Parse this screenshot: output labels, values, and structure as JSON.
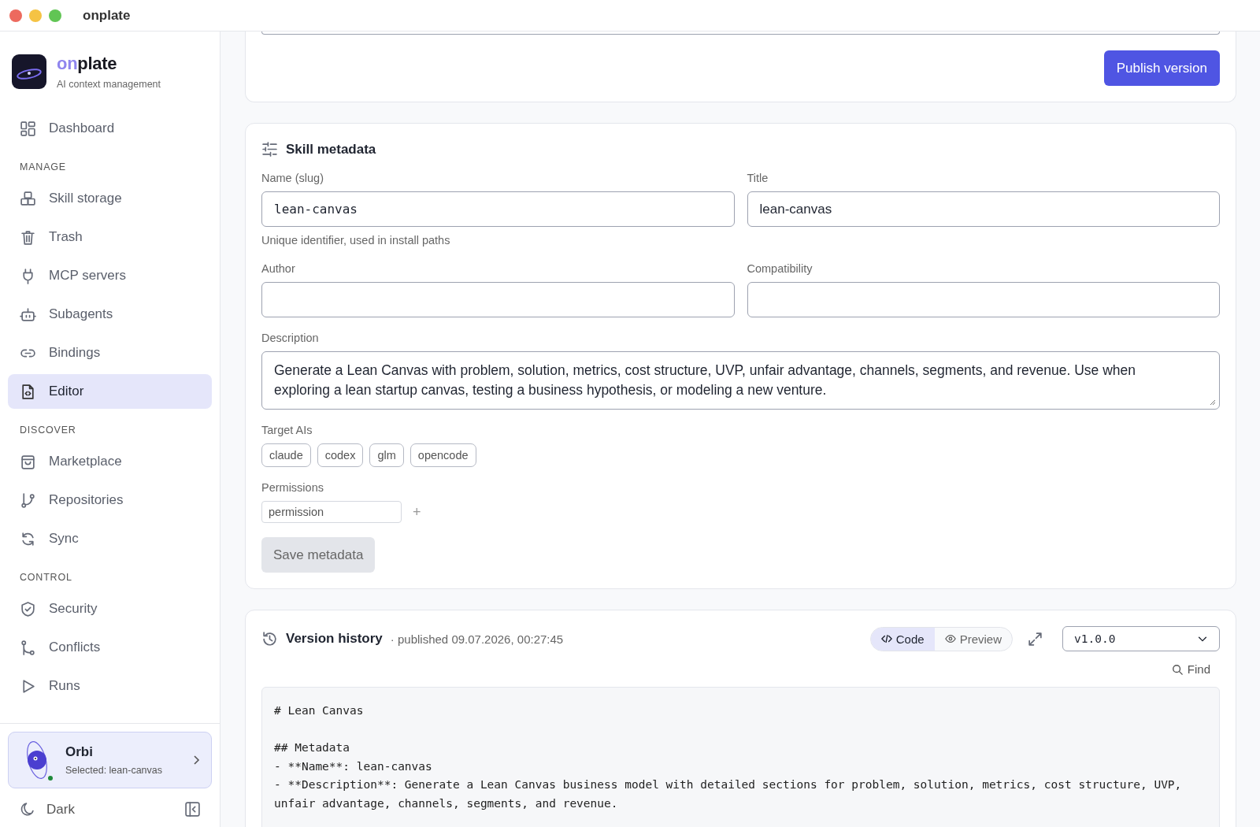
{
  "window": {
    "title": "onplate"
  },
  "brand": {
    "name_accent": "on",
    "name_rest": "plate",
    "tagline": "AI context management"
  },
  "sidebar": {
    "top_items": [
      {
        "label": "Dashboard",
        "selected": false
      }
    ],
    "sections": [
      {
        "heading": "MANAGE",
        "items": [
          {
            "label": "Skill storage",
            "selected": false
          },
          {
            "label": "Trash",
            "selected": false
          },
          {
            "label": "MCP servers",
            "selected": false
          },
          {
            "label": "Subagents",
            "selected": false
          },
          {
            "label": "Bindings",
            "selected": false
          },
          {
            "label": "Editor",
            "selected": true
          }
        ]
      },
      {
        "heading": "DISCOVER",
        "items": [
          {
            "label": "Marketplace",
            "selected": false
          },
          {
            "label": "Repositories",
            "selected": false
          },
          {
            "label": "Sync",
            "selected": false
          }
        ]
      },
      {
        "heading": "CONTROL",
        "items": [
          {
            "label": "Security",
            "selected": false
          },
          {
            "label": "Conflicts",
            "selected": false
          },
          {
            "label": "Runs",
            "selected": false
          }
        ]
      }
    ],
    "assistant": {
      "name": "Orbi",
      "subtitle": "Selected: lean-canvas",
      "online": true
    },
    "theme_toggle": {
      "label": "Dark"
    }
  },
  "publish_button": "Publish version",
  "metadata": {
    "title": "Skill metadata",
    "fields": [
      {
        "label": "Name (slug)",
        "value": "lean-canvas",
        "mono": true,
        "hint": "Unique identifier, used in install paths"
      },
      {
        "label": "Title",
        "value": "lean-canvas",
        "mono": false
      },
      {
        "label": "Author"
      },
      {
        "label": "Compatibility"
      }
    ],
    "description": {
      "label": "Description",
      "value": "Generate a Lean Canvas with problem, solution, metrics, cost structure, UVP, unfair advantage, channels, segments, and revenue. Use when exploring a lean startup canvas, testing a business hypothesis, or modeling a new venture."
    },
    "target_ais": {
      "label": "Target AIs",
      "chips": [
        "claude",
        "codex",
        "glm",
        "opencode"
      ]
    },
    "permissions": {
      "label": "Permissions",
      "placeholder": "permission",
      "add": "+"
    },
    "save_button": {
      "label": "Save metadata",
      "disabled": true
    }
  },
  "version_history": {
    "title": "Version history",
    "published": "· published 09.07.2026, 00:27:45",
    "view_tabs": [
      {
        "label": "Code",
        "selected": true
      },
      {
        "label": "Preview",
        "selected": false
      }
    ],
    "version": "v1.0.0",
    "find": "Find",
    "code": "# Lean Canvas\n\n## Metadata\n- **Name**: lean-canvas\n- **Description**: Generate a Lean Canvas business model with detailed sections for problem, solution, metrics, cost structure, UVP, unfair advantage, channels, segments, and revenue."
  }
}
